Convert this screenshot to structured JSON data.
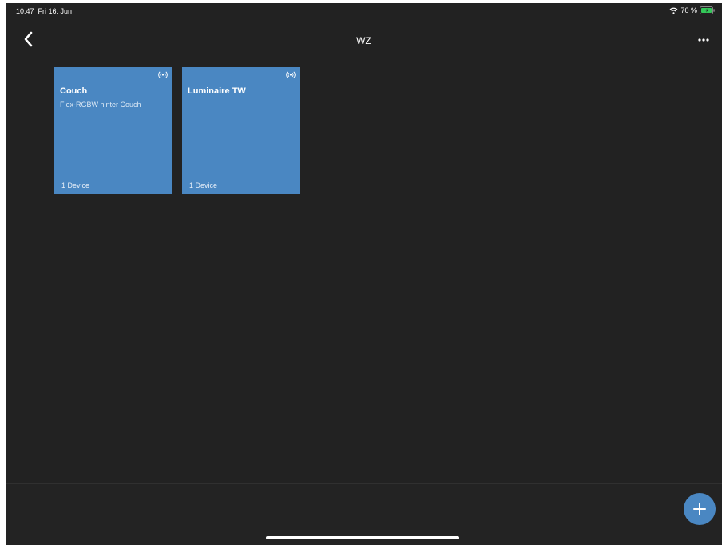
{
  "status_bar": {
    "time": "10:47",
    "date": "Fri 16. Jun",
    "battery": "70 %"
  },
  "nav": {
    "title": "WZ",
    "back_icon": "chevron-left-icon",
    "more_icon": "more-horizontal-icon"
  },
  "tiles": [
    {
      "name": "Couch",
      "subtitle": "Flex-RGBW hinter Couch",
      "count": "1 Device",
      "icon": "signal-icon"
    },
    {
      "name": "Luminaire TW",
      "subtitle": "",
      "count": "1 Device",
      "icon": "signal-icon"
    }
  ],
  "fab": {
    "icon": "plus-icon"
  },
  "colors": {
    "background": "#222222",
    "tile": "#4a87c2",
    "accent": "#4a87c2",
    "battery": "#34c759"
  }
}
